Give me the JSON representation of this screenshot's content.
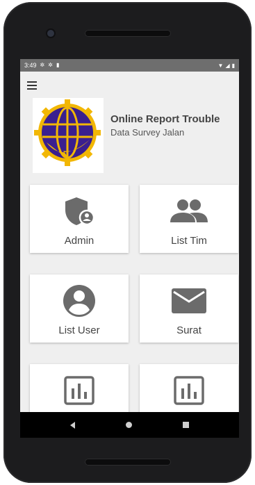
{
  "status_bar": {
    "time": "3:49"
  },
  "app": {
    "title": "Online Report Trouble",
    "subtitle": "Data Survey Jalan"
  },
  "tiles": [
    {
      "label": "Admin",
      "icon": "admin-shield-icon"
    },
    {
      "label": "List Tim",
      "icon": "group-icon"
    },
    {
      "label": "List User",
      "icon": "account-circle-icon"
    },
    {
      "label": "Surat",
      "icon": "mail-icon"
    },
    {
      "label": "",
      "icon": "bar-chart-icon"
    },
    {
      "label": "",
      "icon": "bar-chart-icon"
    }
  ],
  "colors": {
    "icon_gray": "#6b6b6b",
    "status_bar": "#6e6e6e",
    "logo_purple": "#3a1f8f",
    "logo_gold": "#f2b705"
  }
}
